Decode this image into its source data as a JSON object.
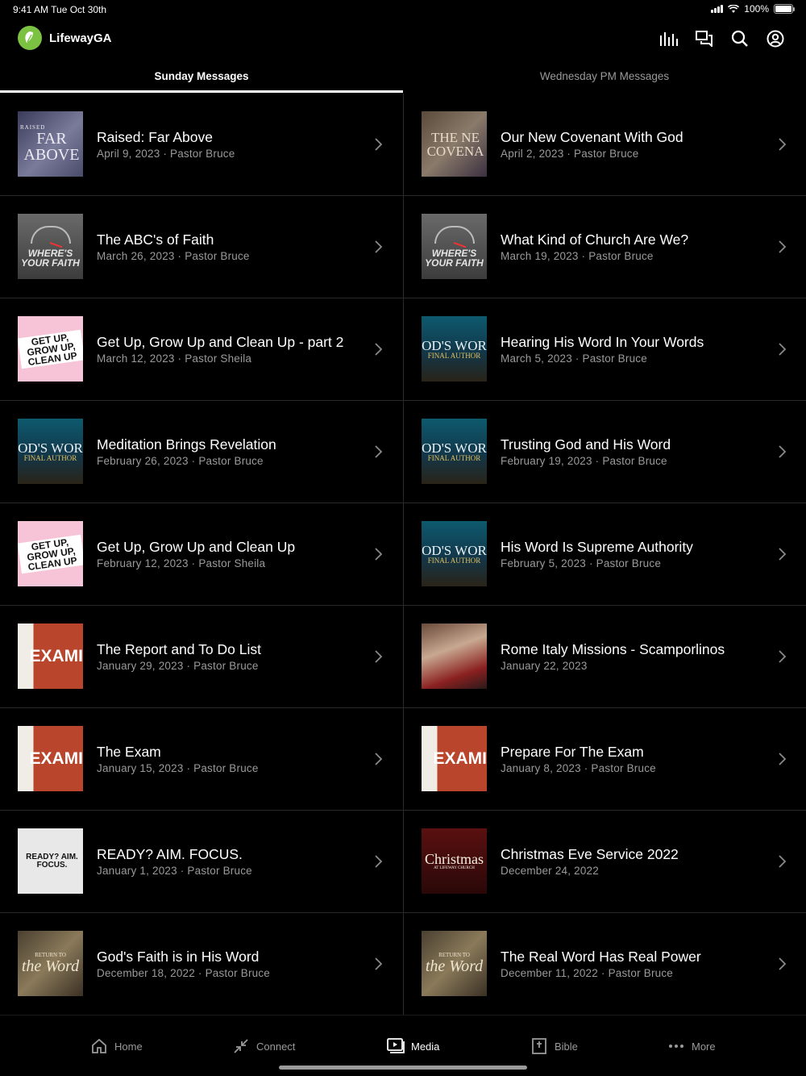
{
  "status_bar": {
    "time_date": "9:41 AM   Tue Oct 30th",
    "battery": "100%"
  },
  "header": {
    "app_name": "LifewayGA",
    "icons": [
      "bars-icon",
      "chat-icon",
      "search-icon",
      "profile-icon"
    ]
  },
  "tabs": [
    {
      "label": "Sunday Messages",
      "active": true
    },
    {
      "label": "Wednesday PM Messages",
      "active": false
    }
  ],
  "sunday": [
    {
      "title": "Raised: Far Above",
      "subtitle": "April 9, 2023 · Pastor Bruce",
      "thumb": "FAR ABOVE",
      "thumb_top": "RAISED"
    },
    {
      "title": "The ABC's of Faith",
      "subtitle": "March 26, 2023 · Pastor Bruce",
      "thumb": "WHERE'S YOUR FAITH"
    },
    {
      "title": "Get Up, Grow Up and Clean Up  - part 2",
      "subtitle": "March 12, 2023 · Pastor Sheila",
      "thumb": "GET UP, GROW UP, CLEAN UP"
    },
    {
      "title": "Meditation Brings Revelation",
      "subtitle": "February 26, 2023 · Pastor Bruce",
      "thumb": "OD'S WOR",
      "thumb_sub": "FINAL AUTHOR"
    },
    {
      "title": "Get Up, Grow Up and Clean Up",
      "subtitle": "February 12, 2023 · Pastor Sheila",
      "thumb": "GET UP, GROW UP, CLEAN UP"
    },
    {
      "title": "The Report and To Do List",
      "subtitle": "January 29, 2023 · Pastor Bruce",
      "thumb": "EXAMI"
    },
    {
      "title": "The Exam",
      "subtitle": "January 15, 2023 · Pastor Bruce",
      "thumb": "EXAMI"
    },
    {
      "title": "READY? AIM. FOCUS.",
      "subtitle": "January 1, 2023 · Pastor Bruce",
      "thumb": "READY? AIM. FOCUS."
    },
    {
      "title": "God's Faith is in His Word",
      "subtitle": "December 18, 2022 · Pastor Bruce",
      "thumb": "the Word",
      "thumb_top": "RETURN TO"
    }
  ],
  "wednesday": [
    {
      "title": "Our New Covenant With God",
      "subtitle": "April 2, 2023 · Pastor Bruce",
      "thumb": "THE NE COVENA"
    },
    {
      "title": "What Kind of Church Are We?",
      "subtitle": "March 19, 2023 · Pastor Bruce",
      "thumb": "WHERE'S YOUR FAITH"
    },
    {
      "title": "Hearing His Word In Your Words",
      "subtitle": "March 5, 2023 · Pastor Bruce",
      "thumb": "OD'S WOR",
      "thumb_sub": "FINAL AUTHOR"
    },
    {
      "title": "Trusting God and His Word",
      "subtitle": "February 19, 2023 · Pastor Bruce",
      "thumb": "OD'S WOR",
      "thumb_sub": "FINAL AUTHOR"
    },
    {
      "title": "His Word Is Supreme Authority",
      "subtitle": "February 5, 2023 · Pastor Bruce",
      "thumb": "OD'S WOR",
      "thumb_sub": "FINAL AUTHOR"
    },
    {
      "title": "Rome Italy Missions - Scamporlinos",
      "subtitle": "January 22, 2023",
      "thumb": ""
    },
    {
      "title": "Prepare For The Exam",
      "subtitle": "January 8, 2023 · Pastor Bruce",
      "thumb": "EXAMI"
    },
    {
      "title": "Christmas Eve Service 2022",
      "subtitle": "December 24, 2022",
      "thumb": "Christmas",
      "thumb_sub": "AT LIFEWAY CHURCH"
    },
    {
      "title": "The Real Word Has Real Power",
      "subtitle": "December 11, 2022 · Pastor Bruce",
      "thumb": "the Word",
      "thumb_top": "RETURN TO"
    }
  ],
  "bottom_nav": [
    {
      "label": "Home",
      "icon": "home-icon",
      "active": false
    },
    {
      "label": "Connect",
      "icon": "connect-icon",
      "active": false
    },
    {
      "label": "Media",
      "icon": "media-icon",
      "active": true
    },
    {
      "label": "Bible",
      "icon": "bible-icon",
      "active": false
    },
    {
      "label": "More",
      "icon": "more-icon",
      "active": false
    }
  ]
}
